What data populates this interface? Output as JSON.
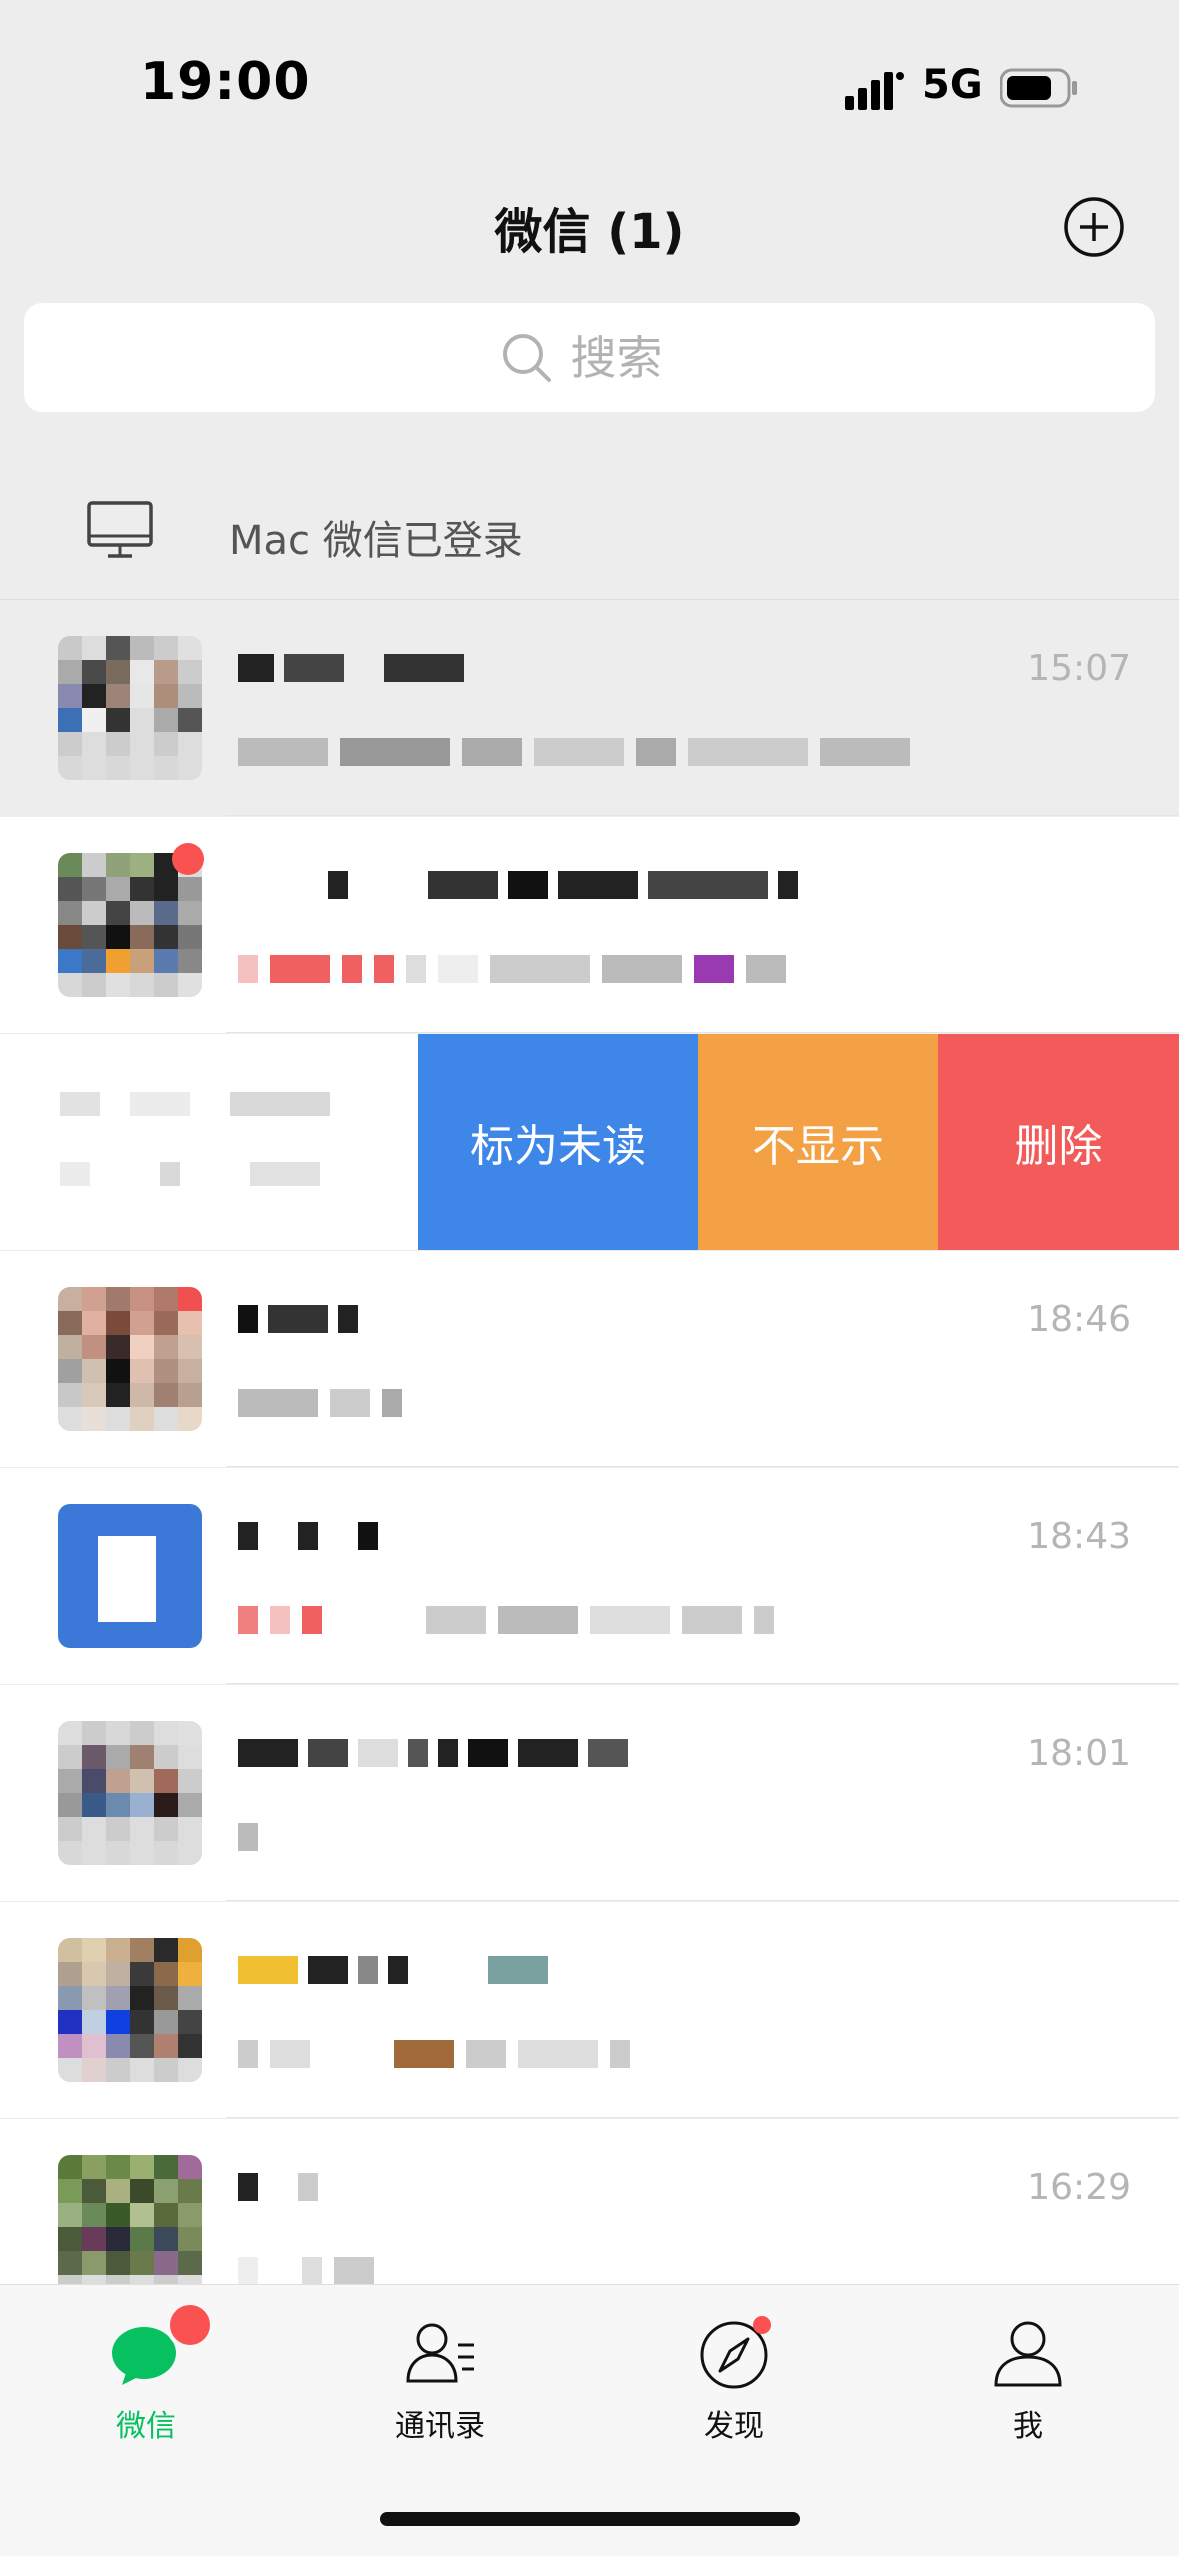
{
  "status_bar": {
    "time": "19:00",
    "network": "5G"
  },
  "header": {
    "title": "微信 (1)",
    "add_icon": "plus-circle-icon"
  },
  "search": {
    "placeholder": "搜索",
    "icon": "search-icon"
  },
  "device_login": {
    "text": "Mac 微信已登录",
    "icon": "desktop-icon"
  },
  "chats": [
    {
      "time": "15:07",
      "pinned": true,
      "badge": false
    },
    {
      "time": "",
      "pinned": false,
      "badge": true
    },
    {
      "time": "18:46",
      "pinned": false,
      "badge": true
    },
    {
      "time": "18:43",
      "pinned": false,
      "badge": false
    },
    {
      "time": "18:01",
      "pinned": false,
      "badge": false
    },
    {
      "time": "",
      "pinned": false,
      "badge": false
    },
    {
      "time": "16:29",
      "pinned": false,
      "badge": false
    }
  ],
  "swipe_actions": {
    "mark_unread": "标为未读",
    "hide": "不显示",
    "delete": "删除",
    "colors": {
      "mark_unread": "#3e87e8",
      "hide": "#f4a045",
      "delete": "#f35a5a"
    }
  },
  "tabs": [
    {
      "label": "微信",
      "icon": "chat-bubble-icon",
      "active": true
    },
    {
      "label": "通讯录",
      "icon": "contacts-icon",
      "active": false
    },
    {
      "label": "发现",
      "icon": "compass-icon",
      "active": false
    },
    {
      "label": "我",
      "icon": "person-icon",
      "active": false
    }
  ],
  "accent": "#07c160"
}
